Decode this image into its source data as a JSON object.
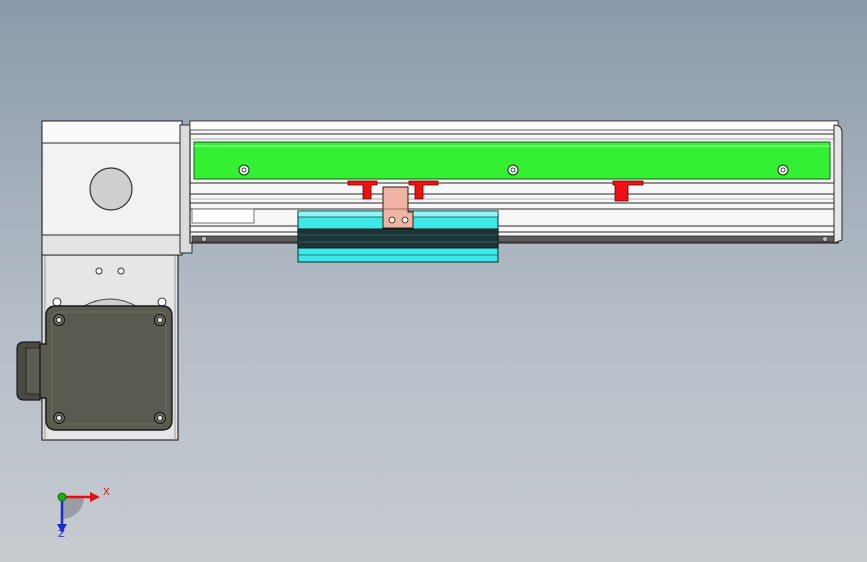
{
  "model": {
    "components": [
      "gearbox-housing",
      "rail-profile",
      "green-guide-strip",
      "red-clamp",
      "copper-bracket",
      "cyan-carriage",
      "motor-plate",
      "motor-body",
      "motor-cable-gland"
    ]
  },
  "triad": {
    "x_label": "X",
    "z_label": "Z",
    "colors": {
      "x": "#e0101a",
      "y": "#18b018",
      "z": "#1a2bd8"
    }
  },
  "colors": {
    "background_top": "#8b9aab",
    "background_bottom": "#c7ccd1",
    "guide": "#33f033",
    "clamp": "#ee1111",
    "bracket": "#f0b4a4",
    "carriage": "#3fe8e8",
    "motor": "#5a5a50",
    "housing": "#f2f2f2"
  }
}
